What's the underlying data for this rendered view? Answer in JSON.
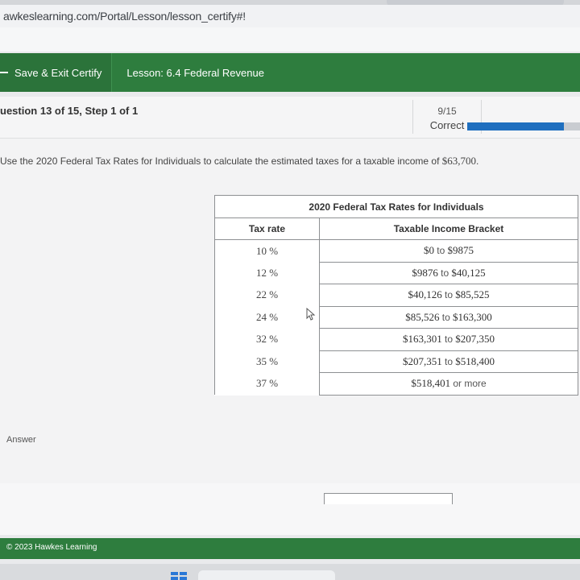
{
  "browser": {
    "url": "awkeslearning.com/Portal/Lesson/lesson_certify#!"
  },
  "header": {
    "save_exit_label": "Save & Exit Certify",
    "lesson_title": "Lesson: 6.4 Federal Revenue"
  },
  "question_bar": {
    "label": "uestion 13 of 15, Step 1 of 1",
    "score": "9/15",
    "status": "Correct",
    "progress_fraction": 0.86
  },
  "question": {
    "text_prefix": "Use the 2020 Federal Tax Rates for Individuals to calculate the estimated taxes for a taxable income of ",
    "amount": "$63,700",
    "text_suffix": "."
  },
  "tax_table": {
    "caption": "2020 Federal Tax Rates for Individuals",
    "col_rate": "Tax rate",
    "col_bracket": "Taxable Income Bracket",
    "rows": [
      {
        "rate": "10 %",
        "low": "$0",
        "joiner": "to",
        "high": "$9875"
      },
      {
        "rate": "12 %",
        "low": "$9876",
        "joiner": "to",
        "high": "$40,125"
      },
      {
        "rate": "22 %",
        "low": "$40,126",
        "joiner": "to",
        "high": "$85,525"
      },
      {
        "rate": "24 %",
        "low": "$85,526",
        "joiner": "to",
        "high": "$163,300"
      },
      {
        "rate": "32 %",
        "low": "$163,301",
        "joiner": "to",
        "high": "$207,350"
      },
      {
        "rate": "35 %",
        "low": "$207,351",
        "joiner": "to",
        "high": "$518,400"
      },
      {
        "rate": "37 %",
        "low": "$518,401",
        "joiner": "or more",
        "high": ""
      }
    ]
  },
  "answer": {
    "label": "Answer"
  },
  "footer": {
    "copyright": "© 2023 Hawkes Learning"
  },
  "colors": {
    "brand_green": "#2e7d3e",
    "progress_blue": "#1f6fbf"
  }
}
